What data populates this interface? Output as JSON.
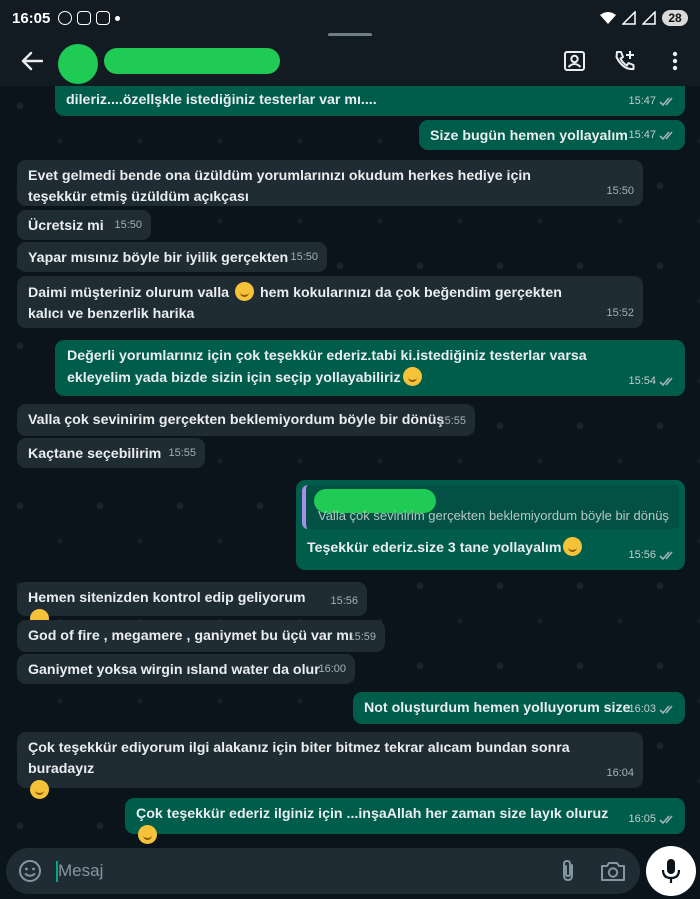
{
  "status_bar": {
    "time": "16:05",
    "battery": "28"
  },
  "composer": {
    "placeholder": "Mesaj"
  },
  "messages": [
    {
      "dir": "out",
      "text": "dileriz....özellşkle istediğiniz testerlar var mı....",
      "time": "15:47"
    },
    {
      "dir": "out",
      "text": "Size bugün hemen yollayalım",
      "time": "15:47"
    },
    {
      "dir": "in",
      "text": "Evet gelmedi bende ona üzüldüm yorumlarınızı okudum herkes hediye için teşekkür etmiş üzüldüm açıkçası",
      "time": "15:50"
    },
    {
      "dir": "in",
      "text": "Ücretsiz mi",
      "time": "15:50"
    },
    {
      "dir": "in",
      "text": "Yapar mısınız böyle bir iyilik gerçekten",
      "time": "15:50"
    },
    {
      "dir": "in",
      "text_a": "Daimi müşteriniz olurum valla",
      "text_b": "hem kokularınızı da çok beğendim gerçekten kalıcı ve benzerlik harika",
      "time": "15:52"
    },
    {
      "dir": "out",
      "text": "Değerli yorumlarınız için çok teşekkür ederiz.tabi ki.istediğiniz testerlar  varsa ekleyelim yada bizde sizin için seçip yollayabiliriz",
      "time": "15:54"
    },
    {
      "dir": "in",
      "text": "Valla çok sevinirim gerçekten beklemiyordum böyle bir dönüş",
      "time": "15:55"
    },
    {
      "dir": "in",
      "text": "Kaçtane seçebilirim",
      "time": "15:55"
    },
    {
      "dir": "out",
      "quote": "Valla çok sevinirim gerçekten beklemiyordum böyle bir dönüş",
      "text": "Teşekkür ederiz.size 3 tane yollayalım",
      "time": "15:56"
    },
    {
      "dir": "in",
      "text": "Hemen sitenizden kontrol edip geliyorum",
      "time": "15:56"
    },
    {
      "dir": "in",
      "text": "God of fire , megamere , ganiymet bu üçü var mı",
      "time": "15:59"
    },
    {
      "dir": "in",
      "text": "Ganiymet yoksa wirgin ısland water da olur",
      "time": "16:00"
    },
    {
      "dir": "out",
      "text": "Not oluşturdum hemen yolluyorum size",
      "time": "16:03"
    },
    {
      "dir": "in",
      "text": "Çok teşekkür ediyorum ilgi alakanız için biter bitmez tekrar alıcam bundan sonra buradayız",
      "time": "16:04"
    },
    {
      "dir": "out",
      "text": "Çok teşekkür ederiz ilginiz için  ...inşaAllah her zaman size layık oluruz",
      "time": "16:05"
    }
  ]
}
